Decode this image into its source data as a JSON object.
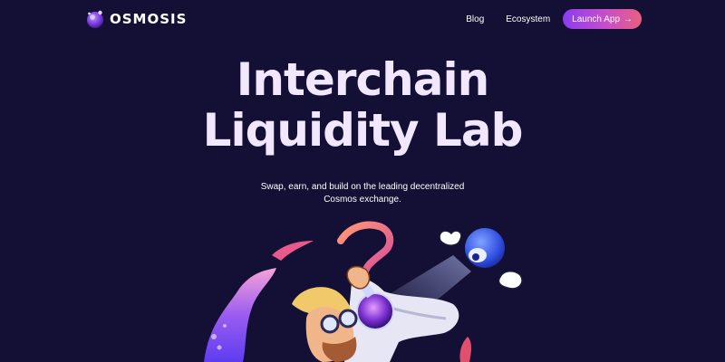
{
  "brand": {
    "name": "OSMOSIS",
    "icon": "osmosis-logo-icon"
  },
  "nav": {
    "links": [
      {
        "label": "Blog"
      },
      {
        "label": "Ecosystem"
      }
    ],
    "cta": {
      "label": "Launch App",
      "arrow": "→"
    }
  },
  "hero": {
    "title_line1": "Interchain",
    "title_line2": "Liquidity Lab",
    "subtitle_line1": "Swap, earn, and build on the leading decentralized",
    "subtitle_line2": "Cosmos exchange."
  },
  "illustration": {
    "name": "scientist-with-flask-and-robot"
  },
  "colors": {
    "background": "#140f34",
    "title": "#f1e8ff",
    "cta_start": "#8a3df0",
    "cta_end": "#e8607e"
  }
}
